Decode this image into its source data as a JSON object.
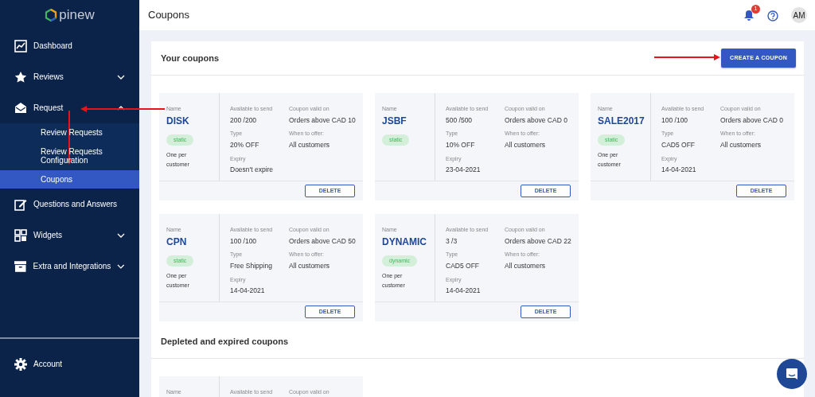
{
  "sidebar": {
    "logo": "pinew",
    "items": [
      {
        "label": "Dashboard",
        "selected": false
      },
      {
        "label": "Reviews",
        "selected": false,
        "expanded": false
      },
      {
        "label": "Request",
        "selected": false,
        "expanded": true,
        "children": [
          {
            "label": "Review Requests",
            "selected": false
          },
          {
            "label": "Review Requests Configuration",
            "selected": false
          },
          {
            "label": "Coupons",
            "selected": true
          }
        ]
      },
      {
        "label": "Questions and Answers",
        "selected": false
      },
      {
        "label": "Widgets",
        "selected": false,
        "expanded": false
      },
      {
        "label": "Extra and Integrations",
        "selected": false,
        "expanded": false
      }
    ],
    "footer_item": {
      "label": "Account"
    }
  },
  "header": {
    "title": "Coupons",
    "notification_count": "1",
    "avatar": "AM"
  },
  "sections": [
    {
      "title": "Your coupons",
      "action": "CREATE A COUPON",
      "coupons": [
        {
          "name_label": "Name",
          "name": "DISK",
          "tag": "static",
          "limit": "One per customer",
          "fields": [
            {
              "label": "Available to send",
              "value": "200 /200"
            },
            {
              "label": "Coupon valid on",
              "value": "Orders above CAD 10"
            },
            {
              "label": "Type",
              "value": "20% OFF"
            },
            {
              "label": "When to offer:",
              "value": "All customers"
            },
            {
              "label": "Expiry",
              "value": "Doesn't expire"
            }
          ],
          "button": "DELETE"
        },
        {
          "name_label": "Name",
          "name": "JSBF",
          "tag": "static",
          "fields": [
            {
              "label": "Available to send",
              "value": "500 /500"
            },
            {
              "label": "Coupon valid on",
              "value": "Orders above CAD 0"
            },
            {
              "label": "Type",
              "value": "10% OFF"
            },
            {
              "label": "When to offer:",
              "value": "All customers"
            },
            {
              "label": "Expiry",
              "value": "23-04-2021"
            }
          ],
          "button": "DELETE"
        },
        {
          "name_label": "Name",
          "name": "SALE2017",
          "tag": "static",
          "limit": "One per customer",
          "fields": [
            {
              "label": "Available to send",
              "value": "100 /100"
            },
            {
              "label": "Coupon valid on",
              "value": "Orders above CAD 0"
            },
            {
              "label": "Type",
              "value": "CAD5 OFF"
            },
            {
              "label": "When to offer:",
              "value": "All customers"
            },
            {
              "label": "Expiry",
              "value": "14-04-2021"
            }
          ],
          "button": "DELETE"
        },
        {
          "name_label": "Name",
          "name": "CPN",
          "tag": "static",
          "limit": "One per customer",
          "fields": [
            {
              "label": "Available to send",
              "value": "100 /100"
            },
            {
              "label": "Coupon valid on",
              "value": "Orders above CAD 50"
            },
            {
              "label": "Type",
              "value": "Free Shipping"
            },
            {
              "label": "When to offer:",
              "value": "All customers"
            },
            {
              "label": "Expiry",
              "value": "14-04-2021"
            }
          ],
          "button": "DELETE"
        },
        {
          "name_label": "Name",
          "name": "DYNAMIC",
          "tag": "dynamic",
          "limit": "One per customer",
          "fields": [
            {
              "label": "Available to send",
              "value": "3 /3"
            },
            {
              "label": "Coupon valid on",
              "value": "Orders above CAD 22"
            },
            {
              "label": "Type",
              "value": "CAD5 OFF"
            },
            {
              "label": "When to offer:",
              "value": "All customers"
            },
            {
              "label": "Expiry",
              "value": "14-04-2021"
            }
          ],
          "button": "DELETE"
        }
      ]
    },
    {
      "title": "Depleted and expired coupons",
      "coupons": [
        {
          "name_label": "Name",
          "fields": [
            {
              "label": "Available to send"
            },
            {
              "label": "Coupon valid on"
            }
          ]
        }
      ]
    }
  ]
}
